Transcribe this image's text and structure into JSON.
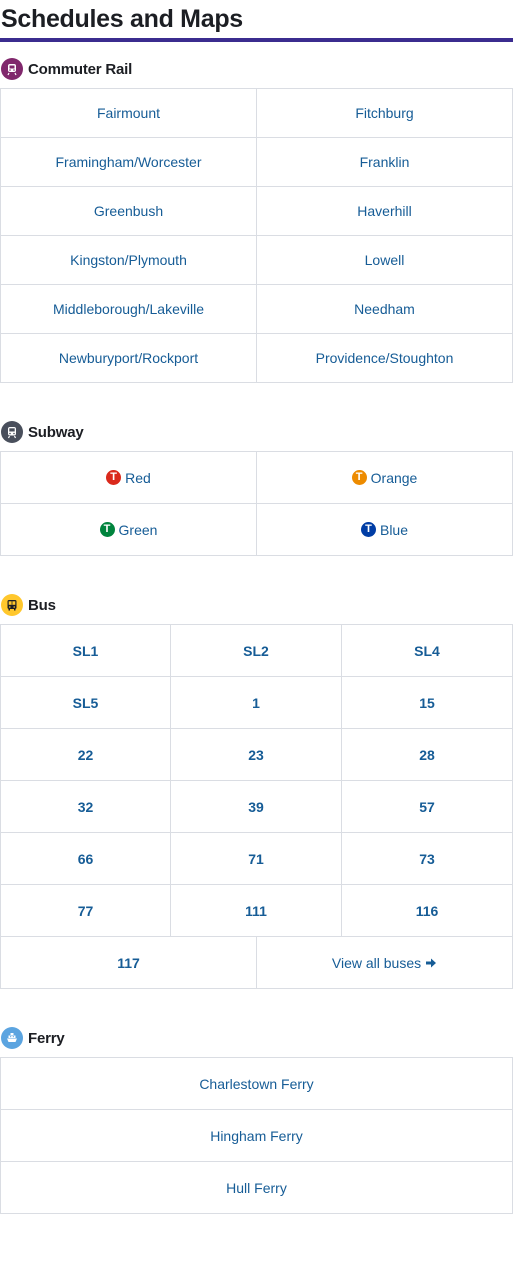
{
  "page": {
    "title": "Schedules and Maps"
  },
  "colors": {
    "title_rule": "#3b2c8f",
    "link": "#165c96",
    "commuter_rail": "#80276c",
    "subway": "#494f5c",
    "bus": "#ffc72c",
    "ferry": "#5ba4e0",
    "red_line": "#da291c",
    "orange_line": "#ed8b00",
    "green_line": "#00843d",
    "blue_line": "#003da5"
  },
  "commuter_rail": {
    "title": "Commuter Rail",
    "icon": "commuter-rail-icon",
    "lines": [
      "Fairmount",
      "Fitchburg",
      "Framingham/Worcester",
      "Franklin",
      "Greenbush",
      "Haverhill",
      "Kingston/Plymouth",
      "Lowell",
      "Middleborough/Lakeville",
      "Needham",
      "Newburyport/Rockport",
      "Providence/Stoughton"
    ]
  },
  "subway": {
    "title": "Subway",
    "icon": "subway-icon",
    "lines": [
      {
        "label": "Red",
        "icon": "t-logo-icon"
      },
      {
        "label": "Orange",
        "icon": "t-logo-icon"
      },
      {
        "label": "Green",
        "icon": "t-logo-icon"
      },
      {
        "label": "Blue",
        "icon": "t-logo-icon"
      }
    ]
  },
  "bus": {
    "title": "Bus",
    "icon": "bus-icon",
    "routes": [
      "SL1",
      "SL2",
      "SL4",
      "SL5",
      "1",
      "15",
      "22",
      "23",
      "28",
      "32",
      "39",
      "57",
      "66",
      "71",
      "73",
      "77",
      "111",
      "116"
    ],
    "last_route": "117",
    "view_all": "View all buses",
    "view_all_icon": "arrow-right-icon"
  },
  "ferry": {
    "title": "Ferry",
    "icon": "ferry-icon",
    "routes": [
      "Charlestown Ferry",
      "Hingham Ferry",
      "Hull Ferry"
    ]
  }
}
